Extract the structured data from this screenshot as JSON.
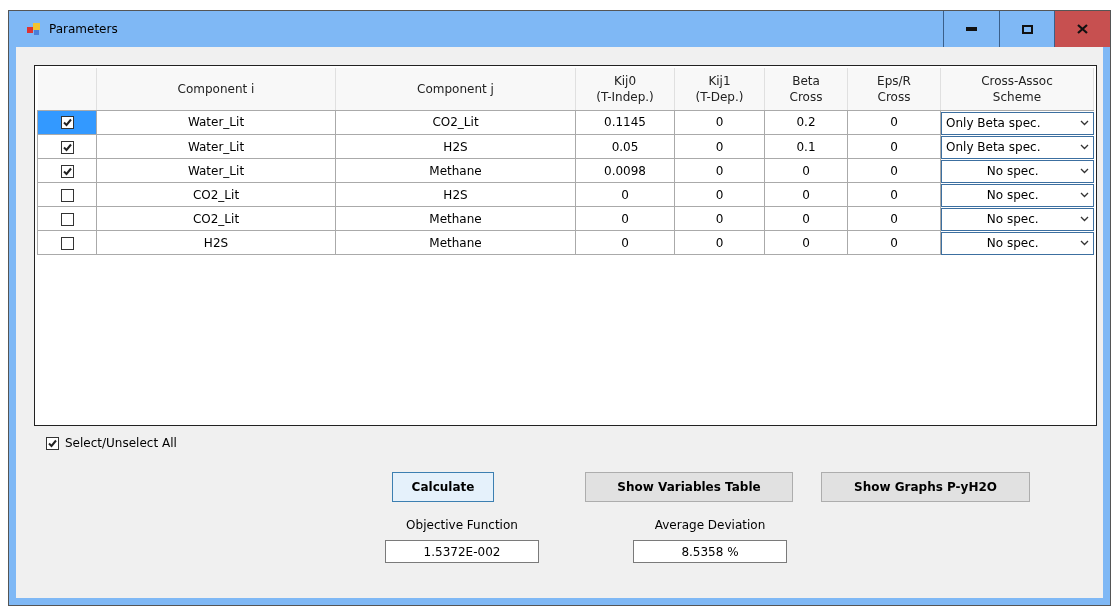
{
  "window": {
    "title": "Parameters"
  },
  "table": {
    "columns": [
      {
        "label": "Component i"
      },
      {
        "label": "Component j"
      },
      {
        "label": "Kij0\n(T-Indep.)"
      },
      {
        "label": "Kij1\n(T-Dep.)"
      },
      {
        "label": "Beta\nCross"
      },
      {
        "label": "Eps/R\nCross"
      },
      {
        "label": "Cross-Assoc\nScheme"
      }
    ],
    "rows": [
      {
        "checked": true,
        "selected": true,
        "cells": [
          "Water_Lit",
          "CO2_Lit",
          "0.1145",
          "0",
          "0.2",
          "0"
        ],
        "scheme": "Only Beta spec."
      },
      {
        "checked": true,
        "selected": false,
        "cells": [
          "Water_Lit",
          "H2S",
          "0.05",
          "0",
          "0.1",
          "0"
        ],
        "scheme": "Only Beta spec."
      },
      {
        "checked": true,
        "selected": false,
        "cells": [
          "Water_Lit",
          "Methane",
          "0.0098",
          "0",
          "0",
          "0"
        ],
        "scheme": "No spec."
      },
      {
        "checked": false,
        "selected": false,
        "cells": [
          "CO2_Lit",
          "H2S",
          "0",
          "0",
          "0",
          "0"
        ],
        "scheme": "No spec."
      },
      {
        "checked": false,
        "selected": false,
        "cells": [
          "CO2_Lit",
          "Methane",
          "0",
          "0",
          "0",
          "0"
        ],
        "scheme": "No spec."
      },
      {
        "checked": false,
        "selected": false,
        "cells": [
          "H2S",
          "Methane",
          "0",
          "0",
          "0",
          "0"
        ],
        "scheme": "No spec."
      }
    ]
  },
  "select_all": {
    "label": "Select/Unselect All",
    "checked": true
  },
  "buttons": [
    {
      "label": "Calculate",
      "selected": true
    },
    {
      "label": "Show Variables Table",
      "selected": false
    },
    {
      "label": "Show Graphs P-yH2O",
      "selected": false
    }
  ],
  "results": [
    {
      "label": "Objective Function",
      "value": "1.5372E-002"
    },
    {
      "label": "Average Deviation",
      "value": "8.5358 %"
    }
  ]
}
